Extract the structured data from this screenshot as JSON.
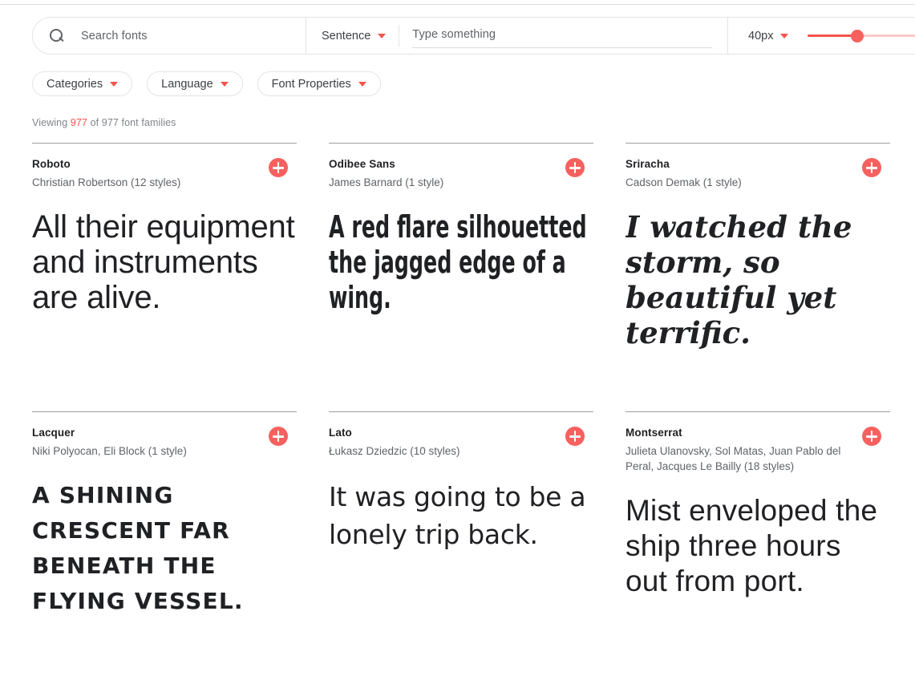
{
  "toolbar": {
    "search_placeholder": "Search fonts",
    "search_icon": "search-icon",
    "preview_type": "Sentence",
    "preview_placeholder": "Type something",
    "size_value": "40px",
    "slider_fill_percent": 32,
    "accent_color": "#f4534d",
    "add_button_color": "#f6615f"
  },
  "filters": [
    {
      "label": "Categories"
    },
    {
      "label": "Language"
    },
    {
      "label": "Font Properties"
    }
  ],
  "status": {
    "prefix": "Viewing",
    "shown": "977",
    "middle": "of",
    "total": "977",
    "suffix": "font families"
  },
  "fonts": [
    {
      "name": "Roboto",
      "author": "Christian Robertson (12 styles)",
      "preview": "All their equipment and instruments are alive.",
      "add_label": "+"
    },
    {
      "name": "Odibee Sans",
      "author": "James Barnard (1 style)",
      "preview": "A red flare silhouetted the jagged edge of a wing.",
      "add_label": "+"
    },
    {
      "name": "Sriracha",
      "author": "Cadson Demak (1 style)",
      "preview": "I watched the storm, so beautiful yet terrific.",
      "add_label": "+"
    },
    {
      "name": "Lacquer",
      "author": "Niki Polyocan, Eli Block (1 style)",
      "preview": "A shining crescent far beneath the flying vessel.",
      "add_label": "+"
    },
    {
      "name": "Lato",
      "author": "Łukasz Dziedzic (10 styles)",
      "preview": "It was going to be a lonely trip back.",
      "add_label": "+"
    },
    {
      "name": "Montserrat",
      "author": "Julieta Ulanovsky, Sol Matas, Juan Pablo del Peral, Jacques Le Bailly (18 styles)",
      "preview": "Mist enveloped the ship three hours out from port.",
      "add_label": "+"
    }
  ]
}
